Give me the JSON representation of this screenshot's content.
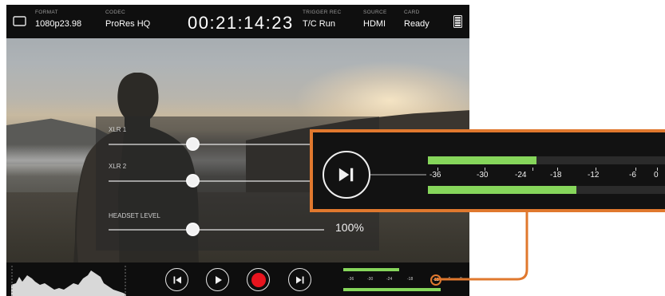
{
  "topbar": {
    "format": {
      "label": "FORMAT",
      "value": "1080p23.98"
    },
    "codec": {
      "label": "CODEC",
      "value": "ProRes HQ"
    },
    "timecode": "00:21:14:23",
    "trigger": {
      "label": "TRIGGER REC",
      "value": "T/C Run"
    },
    "source": {
      "label": "SOURCE",
      "value": "HDMI"
    },
    "card": {
      "label": "CARD",
      "value": "Ready"
    }
  },
  "audio_panel": {
    "tracks": [
      {
        "label": "XLR 1",
        "level": 0.33
      },
      {
        "label": "XLR 2",
        "level": 0.33
      },
      {
        "label": "HEADSET LEVEL",
        "level": 0.33,
        "value": "100%"
      }
    ]
  },
  "meter_scale": [
    "-36",
    "-30",
    "-24",
    "-18",
    "-12",
    "-6",
    "0"
  ],
  "meter_levels": {
    "channel_1": 0.45,
    "channel_2": 0.62
  },
  "mini_meter_highlight": "-12",
  "colors": {
    "accent": "#e0782e",
    "meter_green": "#86d65b",
    "record_red": "#e8141e"
  },
  "icons": [
    "monitor-icon",
    "battery-icon",
    "skip-back-icon",
    "play-icon",
    "record-icon",
    "skip-forward-icon"
  ]
}
